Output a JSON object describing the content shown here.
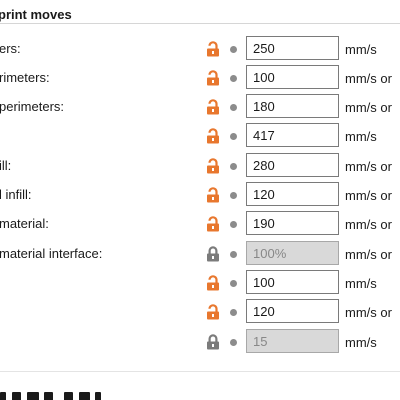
{
  "section": {
    "title": "print moves"
  },
  "rows": [
    {
      "label": "ers:",
      "value": "250",
      "unit": "mm/s",
      "locked": false,
      "enabled": true
    },
    {
      "label": "rimeters:",
      "value": "100",
      "unit": "mm/s or",
      "locked": false,
      "enabled": true
    },
    {
      "label": "perimeters:",
      "value": "180",
      "unit": "mm/s or",
      "locked": false,
      "enabled": true
    },
    {
      "label": "",
      "value": "417",
      "unit": "mm/s",
      "locked": false,
      "enabled": true
    },
    {
      "label": "ill:",
      "value": "280",
      "unit": "mm/s or",
      "locked": false,
      "enabled": true
    },
    {
      "label": "l infill:",
      "value": "120",
      "unit": "mm/s or",
      "locked": false,
      "enabled": true
    },
    {
      "label": "material:",
      "value": "190",
      "unit": "mm/s or",
      "locked": false,
      "enabled": true
    },
    {
      "label": "material interface:",
      "value": "100%",
      "unit": "mm/s or",
      "locked": true,
      "enabled": false
    },
    {
      "label": "",
      "value": "100",
      "unit": "mm/s",
      "locked": false,
      "enabled": true
    },
    {
      "label": "",
      "value": "120",
      "unit": "mm/s or",
      "locked": false,
      "enabled": true
    },
    {
      "label": "",
      "value": "15",
      "unit": "mm/s",
      "locked": true,
      "enabled": false
    }
  ],
  "colors": {
    "unlocked_icon": "#e8772e",
    "locked_icon": "#7b7b7b",
    "dot": "#8c8c8c",
    "disabled_field": "#d9d9d9"
  },
  "icons": {
    "unlocked": "lock-open-icon",
    "locked": "lock-closed-icon",
    "status_dot": "dot-icon"
  }
}
